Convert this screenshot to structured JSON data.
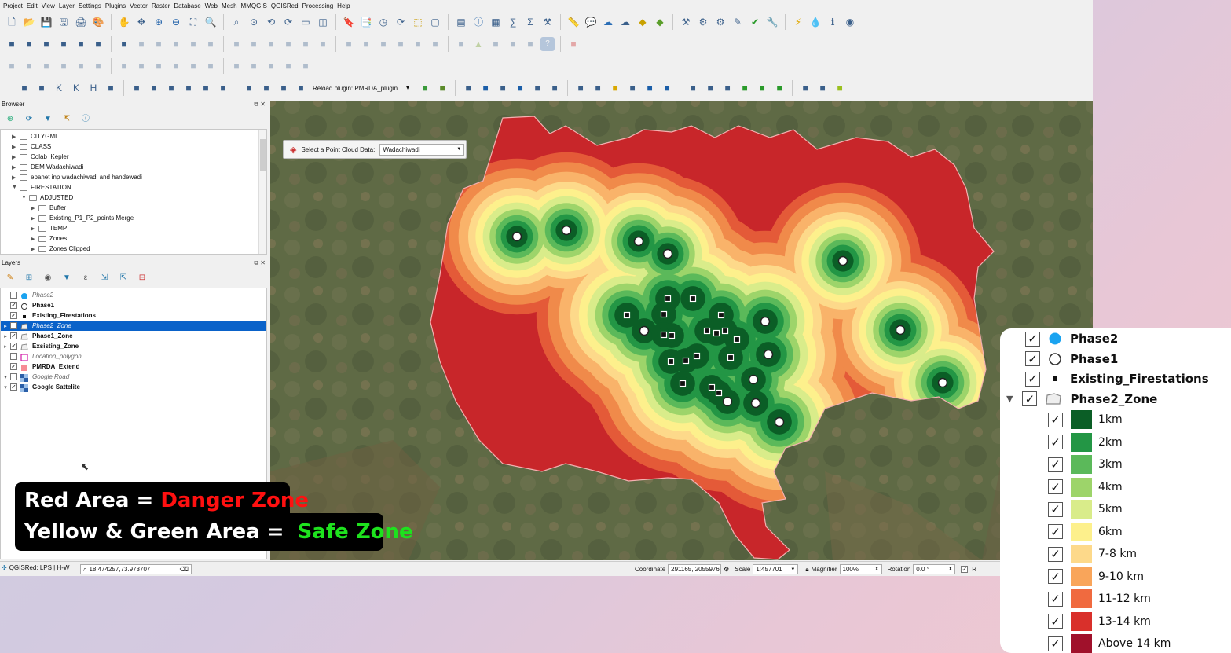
{
  "menu": [
    "Project",
    "Edit",
    "View",
    "Layer",
    "Settings",
    "Plugins",
    "Vector",
    "Raster",
    "Database",
    "Web",
    "Mesh",
    "MMQGIS",
    "QGISRed",
    "Processing",
    "Help"
  ],
  "toolbar": {
    "reload_plugin_label": "Reload plugin: PMRDA_plugin",
    "tb1_icons": [
      "new-project-icon",
      "open-project-icon",
      "save-icon",
      "save-as-icon",
      "print-layout-icon",
      "style-manager-icon",
      "pan-icon",
      "pan-to-selection-icon",
      "zoom-in-icon",
      "zoom-out-icon",
      "zoom-full-icon",
      "zoom-selection-icon",
      "zoom-layer-icon",
      "zoom-native-icon",
      "zoom-last-icon",
      "zoom-next-icon",
      "new-map-view-icon",
      "new-3d-view-icon",
      "bookmark-icon",
      "show-bookmarks-icon",
      "temporal-controller-icon",
      "refresh-icon",
      "select-features-icon",
      "deselect-icon",
      "select-value-icon",
      "identify-icon",
      "attribute-table-icon",
      "field-calculator-icon",
      "statistics-icon",
      "toolbox-icon",
      "measure-icon",
      "map-tips-icon",
      "cloud-icon",
      "cloud-upload-icon",
      "plugin-cube-icon",
      "plugin-cube-green-icon",
      "tools-icon",
      "settings-gear-icon",
      "gear-stack-icon",
      "digitize-icon",
      "check-icon",
      "wrench-icon",
      "lightning-icon",
      "drop-icon",
      "info-icon",
      "github-icon"
    ],
    "tb2_icons": [
      "new-geopackage-icon",
      "new-shapefile-icon",
      "new-virtual-layer-icon",
      "new-gpx-icon",
      "data-source-manager-icon",
      "add-vector-icon",
      "add-raster-icon",
      "toggle-editing-icon",
      "current-edits-icon",
      "save-edits-icon",
      "digitize-line-icon",
      "vertex-tool-icon",
      "delete-selected-icon",
      "cut-icon",
      "copy-icon",
      "paste-icon",
      "undo-icon",
      "redo-icon",
      "label-icon",
      "label-pin-icon",
      "label-abc-icon",
      "label-change-icon",
      "label-move-icon",
      "label-rotate-icon",
      "diagram-icon",
      "triangle-icon",
      "globe-icon",
      "globe-add-icon",
      "globe-gear-icon",
      "help-icon",
      "plugin-red-icon"
    ],
    "tb3_icons": [
      "advanced-digitize-icon",
      "rotate-feature-icon",
      "simplify-icon",
      "add-ring-icon",
      "add-part-icon",
      "fill-ring-icon",
      "delete-ring-icon",
      "delete-part-icon",
      "reshape-icon",
      "offset-curve-icon",
      "split-features-icon",
      "split-parts-icon",
      "merge-features-icon",
      "merge-attributes-icon",
      "rotate-symbols-icon",
      "reverse-line-icon",
      "trim-extend-icon"
    ],
    "tb4_icons": [
      "locator-icon",
      "pen-icon",
      "kml-icon",
      "kmz-icon",
      "html-icon",
      "grid-map-icon",
      "form-icon",
      "python-icon",
      "plugin-settings-icon",
      "layers-stack-icon",
      "chart-icon",
      "import-icon",
      "export-icon",
      "globe-people-icon",
      "photo-icon",
      "reload-icon",
      "layer-green-icon",
      "mountain-icon",
      "cube-layer-icon",
      "s-plugin-icon",
      "flag-icon",
      "square-blue-icon",
      "earth-icon",
      "arrow-circle-icon",
      "map-pin-icon",
      "horse-icon",
      "box-yellow-icon",
      "dome-icon",
      "download-icon",
      "upload-icon",
      "cog-small-icon",
      "bars-icon",
      "checklist-icon",
      "tick1-icon",
      "tick2-icon",
      "tick3-icon",
      "owl-icon",
      "overflow-icon",
      "feather-icon"
    ]
  },
  "browser": {
    "title": "Browser",
    "items": [
      {
        "label": "CITYGML",
        "level": 1,
        "expanded": false
      },
      {
        "label": "CLASS",
        "level": 1,
        "expanded": false
      },
      {
        "label": "Colab_Kepler",
        "level": 1,
        "expanded": false
      },
      {
        "label": "DEM Wadachiwadi",
        "level": 1,
        "expanded": false
      },
      {
        "label": "epanet inp wadachiwadi and handewadi",
        "level": 1,
        "expanded": false
      },
      {
        "label": "FIRESTATION",
        "level": 1,
        "expanded": true
      },
      {
        "label": "ADJUSTED",
        "level": 2,
        "expanded": true
      },
      {
        "label": "Buffer",
        "level": 3,
        "expanded": false
      },
      {
        "label": "Existing_P1_P2_points Merge",
        "level": 3,
        "expanded": false
      },
      {
        "label": "TEMP",
        "level": 3,
        "expanded": false
      },
      {
        "label": "Zones",
        "level": 3,
        "expanded": false
      },
      {
        "label": "Zones Clipped",
        "level": 3,
        "expanded": false
      }
    ]
  },
  "layers": {
    "title": "Layers",
    "items": [
      {
        "label": "Phase2",
        "checked": false,
        "style": "italic",
        "symbol": "circle-blue",
        "expandable": false,
        "selected": false
      },
      {
        "label": "Phase1",
        "checked": true,
        "style": "bold",
        "symbol": "circle-outline",
        "expandable": false,
        "selected": false
      },
      {
        "label": "Existing_Firestations",
        "checked": true,
        "style": "bold",
        "symbol": "square-black",
        "expandable": false,
        "selected": false
      },
      {
        "label": "Phase2_Zone",
        "checked": false,
        "style": "italic",
        "symbol": "polygon",
        "expandable": true,
        "selected": true
      },
      {
        "label": "Phase1_Zone",
        "checked": true,
        "style": "bold",
        "symbol": "polygon",
        "expandable": true,
        "selected": false
      },
      {
        "label": "Exsisting_Zone",
        "checked": true,
        "style": "bold",
        "symbol": "polygon",
        "expandable": true,
        "selected": false
      },
      {
        "label": "Location_polygon",
        "checked": false,
        "style": "italic",
        "symbol": "outline-magenta",
        "expandable": false,
        "selected": false
      },
      {
        "label": "PMRDA_Extend",
        "checked": true,
        "style": "bold",
        "symbol": "fill-pink",
        "expandable": false,
        "selected": false
      },
      {
        "label": "Google Road",
        "checked": false,
        "style": "italic",
        "symbol": "raster",
        "expandable": true,
        "selected": false
      },
      {
        "label": "Google Sattelite",
        "checked": true,
        "style": "bold",
        "symbol": "raster",
        "expandable": true,
        "selected": false
      }
    ]
  },
  "map": {
    "point_cloud_label": "Select a Point Cloud Data:",
    "point_cloud_value": "Wadachiwadi",
    "firestations": [
      [
        658,
        301
      ],
      [
        721,
        293
      ],
      [
        813,
        307
      ],
      [
        850,
        323
      ],
      [
        1073,
        332
      ],
      [
        798,
        401
      ],
      [
        845,
        400
      ],
      [
        850,
        380
      ],
      [
        882,
        380
      ],
      [
        918,
        401
      ],
      [
        820,
        421
      ],
      [
        845,
        426
      ],
      [
        855,
        427
      ],
      [
        900,
        421
      ],
      [
        912,
        424
      ],
      [
        923,
        421
      ],
      [
        938,
        432
      ],
      [
        930,
        455
      ],
      [
        974,
        409
      ],
      [
        978,
        451
      ],
      [
        854,
        460
      ],
      [
        873,
        459
      ],
      [
        887,
        453
      ],
      [
        869,
        488
      ],
      [
        906,
        493
      ],
      [
        915,
        500
      ],
      [
        926,
        511
      ],
      [
        959,
        483
      ],
      [
        962,
        513
      ],
      [
        992,
        537
      ],
      [
        1146,
        420
      ],
      [
        1200,
        487
      ]
    ]
  },
  "statusbar": {
    "plugin_status": "QGISRed: LPS | H-W",
    "locator_value": "18.474257,73.973707",
    "coordinate_label": "Coordinate",
    "coordinate_value": "291165, 2055976",
    "scale_label": "Scale",
    "scale_value": "1:457701",
    "magnifier_label": "Magnifier",
    "magnifier_value": "100%",
    "rotation_label": "Rotation",
    "rotation_value": "0.0 °",
    "render_label": "R"
  },
  "caption": {
    "line1_prefix": "Red Area = ",
    "line1_highlight": "Danger Zone",
    "line2_prefix": "Yellow & Green Area = ",
    "line2_highlight": "Safe Zone"
  },
  "legend": {
    "layers": [
      {
        "label": "Phase2",
        "symbol": "circle-blue"
      },
      {
        "label": "Phase1",
        "symbol": "circle-outline"
      },
      {
        "label": "Existing_Firestations",
        "symbol": "square-black"
      },
      {
        "label": "Phase2_Zone",
        "symbol": "polygon"
      }
    ],
    "classes": [
      {
        "label": "1km",
        "color": "#0b5e26"
      },
      {
        "label": "2km",
        "color": "#239645"
      },
      {
        "label": "3km",
        "color": "#5bb95a"
      },
      {
        "label": "4km",
        "color": "#9dd46a"
      },
      {
        "label": "5km",
        "color": "#d9ec8a"
      },
      {
        "label": "6km",
        "color": "#fdf08c"
      },
      {
        "label": "7-8 km",
        "color": "#fdd98a"
      },
      {
        "label": "9-10 km",
        "color": "#f9a55a"
      },
      {
        "label": "11-12 km",
        "color": "#f06a3f"
      },
      {
        "label": "13-14 km",
        "color": "#d9302b"
      },
      {
        "label": "Above 14 km",
        "color": "#a0112b"
      }
    ]
  },
  "colors": {
    "selection_blue": "#0a62c9",
    "danger_red": "#ff1010",
    "safe_green": "#1ee21e",
    "phase2_blue": "#1aa3f0"
  }
}
